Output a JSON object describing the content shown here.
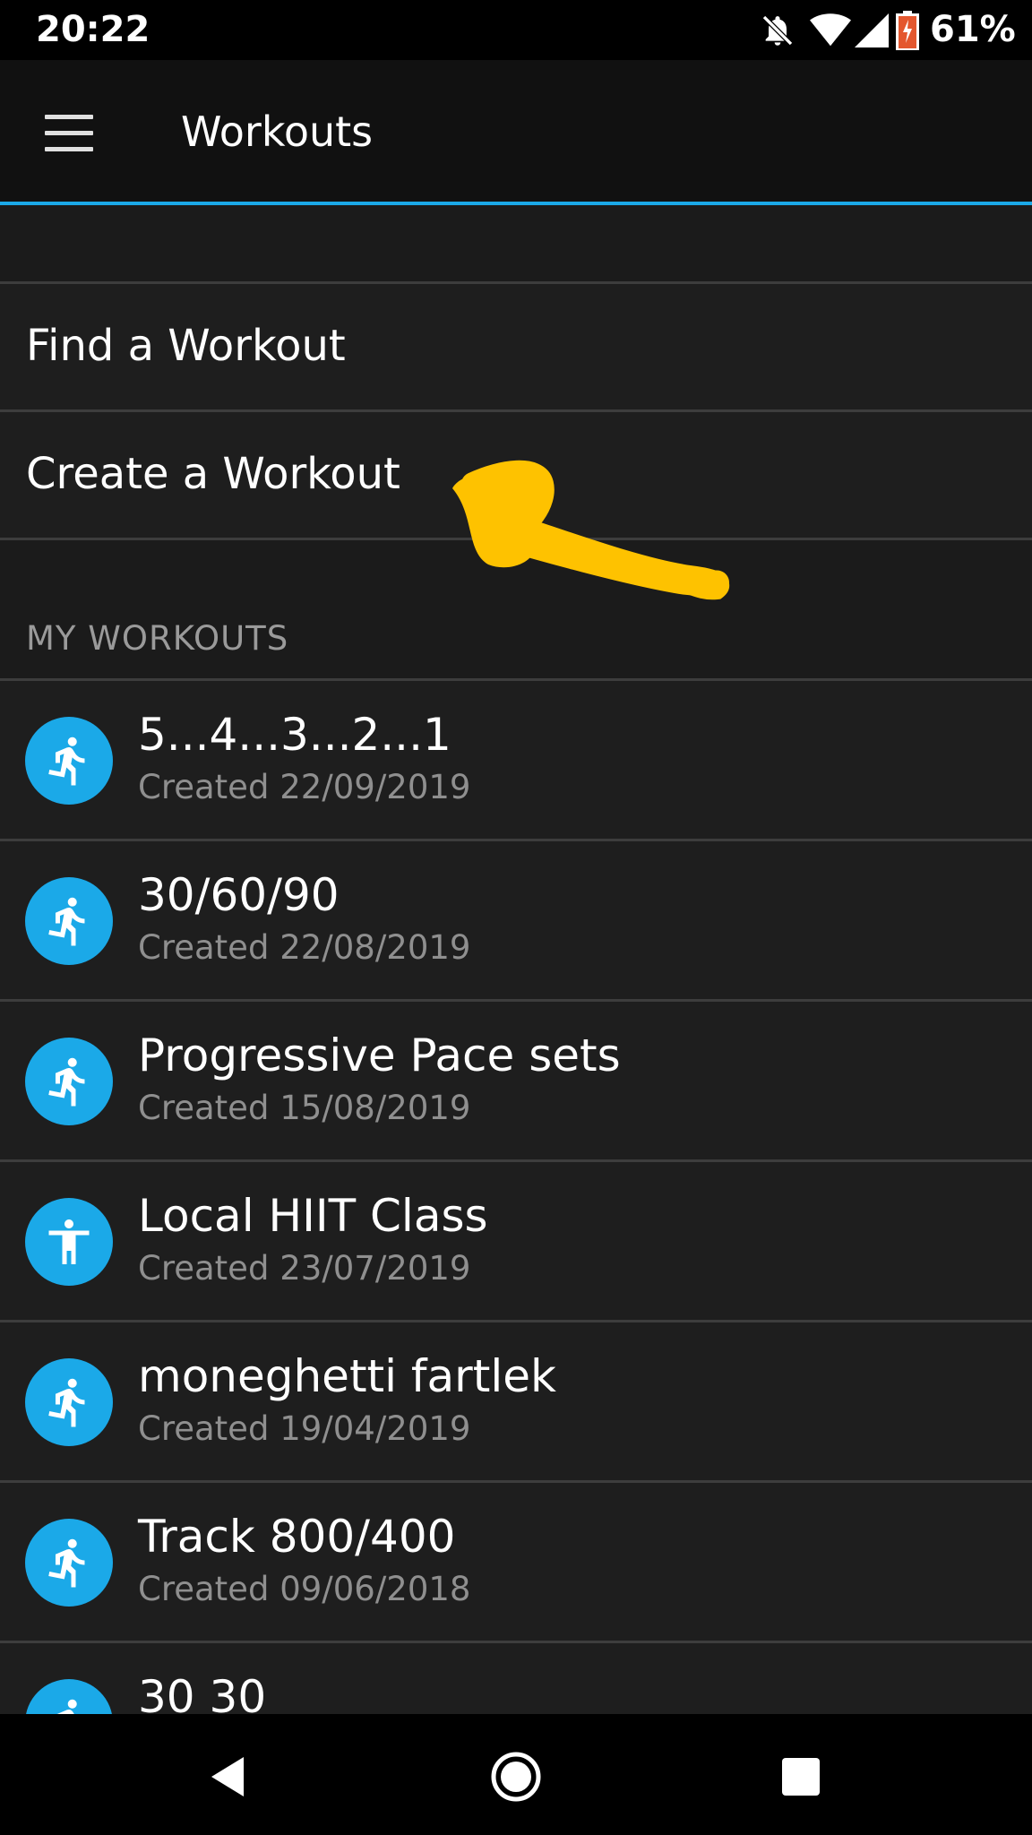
{
  "status_bar": {
    "time": "20:22",
    "battery_percent": "61%",
    "icons": [
      "bell-off-icon",
      "wifi-icon",
      "signal-icon",
      "battery-charging-icon"
    ]
  },
  "app_bar": {
    "title": "Workouts",
    "menu_icon": "hamburger-menu-icon",
    "accent_color": "#1ba9e8"
  },
  "menu": {
    "find_label": "Find a Workout",
    "create_label": "Create a Workout"
  },
  "section": {
    "my_workouts_label": "MY WORKOUTS"
  },
  "workouts": [
    {
      "name": "5...4...3...2...1",
      "created": "Created 22/09/2019",
      "icon": "running-icon"
    },
    {
      "name": "30/60/90",
      "created": "Created 22/08/2019",
      "icon": "running-icon"
    },
    {
      "name": "Progressive Pace sets",
      "created": "Created 15/08/2019",
      "icon": "running-icon"
    },
    {
      "name": "Local HIIT Class",
      "created": "Created 23/07/2019",
      "icon": "person-icon"
    },
    {
      "name": "moneghetti fartlek",
      "created": "Created 19/04/2019",
      "icon": "running-icon"
    },
    {
      "name": "Track 800/400",
      "created": "Created 09/06/2018",
      "icon": "running-icon"
    },
    {
      "name": "30 30",
      "created": "",
      "icon": "running-icon"
    }
  ],
  "nav_bar": {
    "icons": [
      "back-icon",
      "home-icon",
      "recents-icon"
    ]
  },
  "annotation": {
    "color": "#fec200",
    "description": "arrow-annotation"
  }
}
